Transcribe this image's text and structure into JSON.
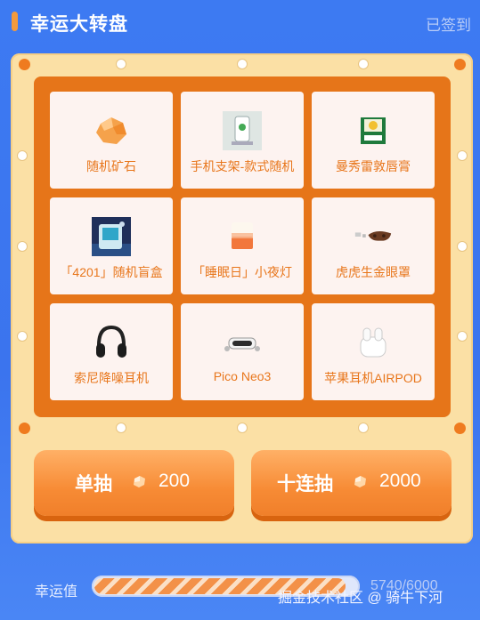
{
  "header": {
    "title": "幸运大转盘",
    "checkin_label": "已签到"
  },
  "prizes": [
    {
      "label": "随机矿石",
      "icon": "ore-icon"
    },
    {
      "label": "手机支架-款式随机",
      "icon": "phone-stand-icon"
    },
    {
      "label": "曼秀雷敦唇膏",
      "icon": "lip-balm-icon"
    },
    {
      "label": "「4201」随机盲盒",
      "icon": "blind-box-icon"
    },
    {
      "label": "「睡眠日」小夜灯",
      "icon": "night-light-icon"
    },
    {
      "label": "虎虎生金眼罩",
      "icon": "eye-mask-icon"
    },
    {
      "label": "索尼降噪耳机",
      "icon": "headphones-icon"
    },
    {
      "label": "Pico Neo3",
      "icon": "vr-headset-icon"
    },
    {
      "label": "苹果耳机AIRPOD",
      "icon": "airpods-icon"
    }
  ],
  "actions": {
    "single": {
      "label": "单抽",
      "cost": "200"
    },
    "ten": {
      "label": "十连抽",
      "cost": "2000"
    }
  },
  "lucky": {
    "label": "幸运值",
    "value_text": "5740/6000",
    "progress": 0.957
  },
  "watermark": "掘金技术社区 @ 骑牛下河",
  "colors": {
    "accent": "#e67519",
    "background": "#3d7af2",
    "frame": "#fbe0a5"
  }
}
